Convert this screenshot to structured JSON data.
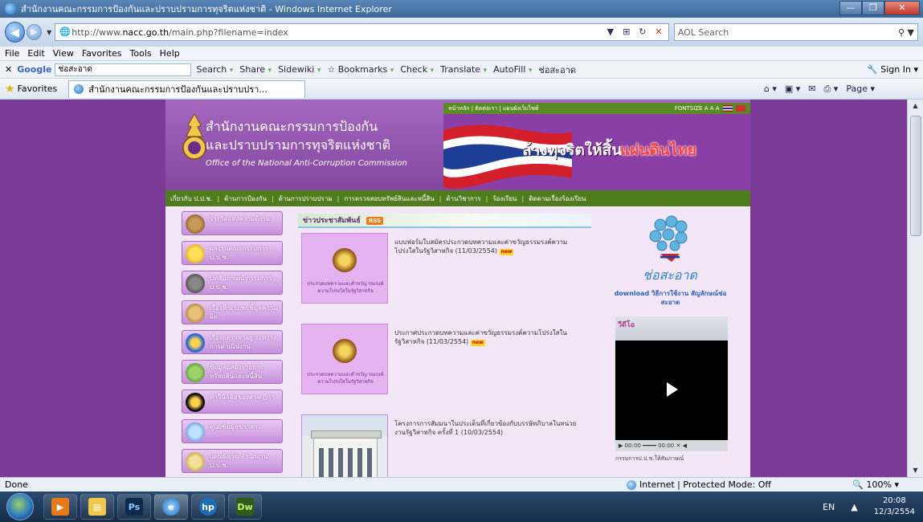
{
  "window": {
    "title": "สำนักงานคณะกรรมการป้องกันและปราบปรามการทุจริตแห่งชาติ - Windows Internet Explorer"
  },
  "address": {
    "url_prefix": "http://www.",
    "url_host": "nacc.go.th",
    "url_path": "/main.php?filename=index",
    "search_placeholder": "AOL Search"
  },
  "menu": [
    "File",
    "Edit",
    "View",
    "Favorites",
    "Tools",
    "Help"
  ],
  "google_bar": {
    "logo": "Google",
    "query": "ช่อสะอาด",
    "items": [
      "Search",
      "Share",
      "Sidewiki",
      "Bookmarks",
      "Check",
      "Translate",
      "AutoFill",
      "ช่อสะอาด"
    ],
    "sign_in": "Sign In"
  },
  "favorites": {
    "label": "Favorites",
    "tab_title": "สำนักงานคณะกรรมการป้องกันและปราบปรา...",
    "page_label": "Page"
  },
  "site": {
    "title_th_1": "สำนักงานคณะกรรมการป้องกัน",
    "title_th_2": "และปราบปรามการทุจริตแห่งชาติ",
    "title_en": "Office of the National Anti-Corruption Commission",
    "top_links": "หน้าหลัก | ติดต่อเรา | แผนผังเว็บไซต์",
    "fontsize_label": "FONTSIZE A A A",
    "slogan_1": "ล้างทุจริตให้สิ้น",
    "slogan_2": "แผ่นดินไทย",
    "colors": {
      "purple": "#7b3a95",
      "green": "#4f7c1d",
      "accent_red": "#ff3b3b"
    }
  },
  "main_nav": [
    "เกี่ยวกับ ป.ป.ช.",
    "ด้านการป้องกัน",
    "ด้านการปราบปราม",
    "การตรวจสอบทรัพย์สินและหนี้สิน",
    "ด้านวิชาการ",
    "ร้องเรียน",
    "ติดตามเรื่องร้องเรียน"
  ],
  "left_menu": [
    {
      "label": "รางวัลแห่งความดีงาม",
      "icon": "award-icon"
    },
    {
      "label": "ผลงานคณะกรรมการ ป.ป.ช.",
      "icon": "star-icon"
    },
    {
      "label": "บทสัมภาษณ์ กรรมการ ป.ป.ช.",
      "icon": "microphone-icon"
    },
    {
      "label": "เรื่องที่ ป.ป.ช. ชี้มูลความผิด",
      "icon": "scales-icon"
    },
    {
      "label": "เรื่องกล่าวหาอยู่ ระหว่างการดำเนินงาน",
      "icon": "target-icon"
    },
    {
      "label": "ข้อมูลแสดงรายการ ทรัพย์สินและหนี้สิน",
      "icon": "money-icon"
    },
    {
      "label": "คำวินิจฉัยของศาล ฎีกา",
      "icon": "judge-icon"
    },
    {
      "label": "ศูนย์ข้อมูลข่าวสาร",
      "icon": "computer-icon"
    },
    {
      "label": "แผนผังเว็บ สำนักงาน ป.ป.ช.",
      "icon": "search-icon"
    }
  ],
  "news": {
    "header": "ข่าวประชาสัมพันธ์",
    "rss": "RSS",
    "new_tag": "new",
    "items": [
      {
        "text": "แบบฟอร์มใบสมัครประกวดบทความและค่าขวัญธรรมรงค์ความโปร่งใสในรัฐวิสาหกิจ (11/03/2554)",
        "caption": "ประกวดบทความและคำขวัญ รณรงค์ความโปร่งใสในรัฐวิสาหกิจ",
        "is_new": true
      },
      {
        "text": "ประกาศประกวดบทความและค่าขวัญธรรมรงค์ความโปร่งใสในรัฐวิสาหกิจ (11/03/2554)",
        "caption": "ประกวดบทความและคำขวัญ รณรงค์ความโปร่งใสในรัฐวิสาหกิจ",
        "is_new": true
      },
      {
        "text": "โครงการการสัมมนาในประเด็นที่เกี่ยวข้องกับบรรษัทภิบาลในหน่วยงานรัฐวิสาหกิจ ครั้งที่ 1 (10/03/2554)",
        "caption": "",
        "is_new": false
      }
    ]
  },
  "right": {
    "logo_text": "ช่อสะอาด",
    "download_text": "download วิธีการใช้งาน สัญลักษณ์ช่อสะอาด",
    "video_header": "วีดีโอ",
    "video_controls": "▶ 00:00 ━━━━ 00:00 ✕ ◀",
    "video_caption": "กรรมการป.ป.ช.ให้สัมภาษณ์"
  },
  "status": {
    "left": "Done",
    "zone": "Internet | Protected Mode: Off",
    "zoom": "100%"
  },
  "taskbar": {
    "lang": "EN",
    "time": "20:08",
    "date": "12/3/2554"
  }
}
